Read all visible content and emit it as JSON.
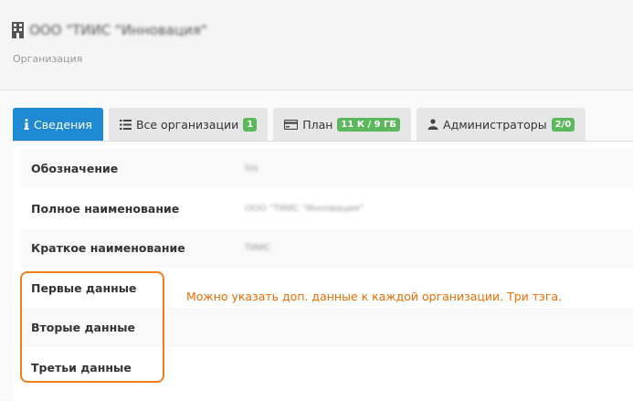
{
  "header": {
    "org_name": "ООО \"ТИИС \"Инновация\"",
    "subtitle": "Организация",
    "icon": "building-icon"
  },
  "tabs": [
    {
      "label": "Сведения",
      "icon": "info-icon",
      "active": true
    },
    {
      "label": "Все организации",
      "icon": "list-icon",
      "badge": "1"
    },
    {
      "label": "План",
      "icon": "card-icon",
      "badge": "11 К / 9 ГБ"
    },
    {
      "label": "Администраторы",
      "icon": "admins-icon",
      "badge": "2/0"
    }
  ],
  "rows": [
    {
      "label": "Обозначение",
      "value": "tiis"
    },
    {
      "label": "Полное наименование",
      "value": "ООО \"ТИИС \"Инновация\""
    },
    {
      "label": "Краткое наименование",
      "value": "ТИИС"
    },
    {
      "label": "Первые данные",
      "value": ""
    },
    {
      "label": "Вторые данные",
      "value": ""
    },
    {
      "label": "Третьи данные",
      "value": ""
    }
  ],
  "annotation": {
    "note": "Можно указать доп. данные к каждой организации. Три тэга.",
    "color": "#f07e1b"
  },
  "colors": {
    "accent": "#1f8ad4",
    "badge": "#5cb85c"
  }
}
